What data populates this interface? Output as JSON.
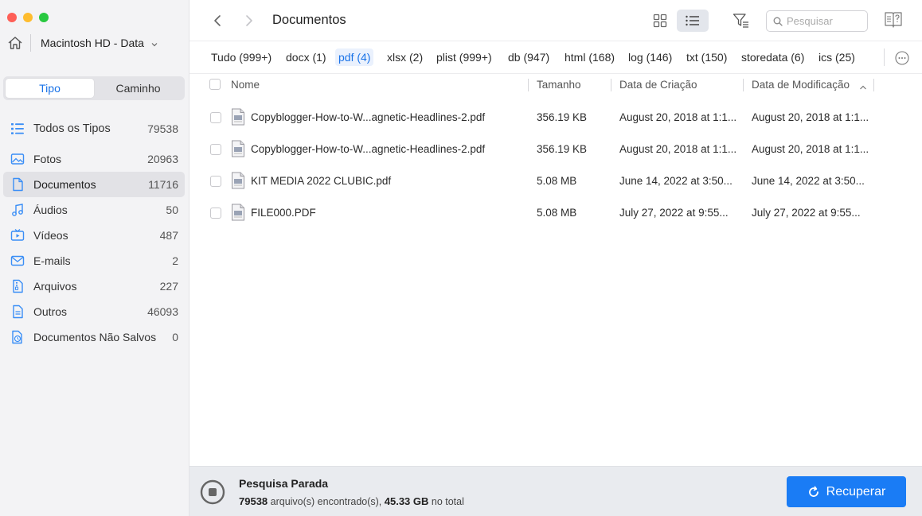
{
  "window": {
    "traffic_colors": [
      "#fe5f57",
      "#febc2e",
      "#28c840"
    ]
  },
  "sidebar": {
    "drive_label": "Macintosh HD - Data",
    "segment": {
      "tipo": "Tipo",
      "caminho": "Caminho"
    },
    "categories": [
      {
        "label": "Todos os Tipos",
        "count": "79538",
        "icon": "all-types-icon"
      },
      {
        "label": "Fotos",
        "count": "20963",
        "icon": "photo-icon"
      },
      {
        "label": "Documentos",
        "count": "11716",
        "icon": "document-icon"
      },
      {
        "label": "Áudios",
        "count": "50",
        "icon": "audio-icon"
      },
      {
        "label": "Vídeos",
        "count": "487",
        "icon": "video-icon"
      },
      {
        "label": "E-mails",
        "count": "2",
        "icon": "email-icon"
      },
      {
        "label": "Arquivos",
        "count": "227",
        "icon": "archive-icon"
      },
      {
        "label": "Outros",
        "count": "46093",
        "icon": "others-icon"
      },
      {
        "label": "Documentos Não Salvos",
        "count": "0",
        "icon": "unsaved-docs-icon"
      }
    ]
  },
  "toolbar": {
    "title": "Documentos",
    "search_placeholder": "Pesquisar"
  },
  "filters": [
    "Tudo (999+)",
    "docx (1)",
    "pdf (4)",
    "xlsx (2)",
    "plist (999+)",
    "db (947)",
    "html (168)",
    "log (146)",
    "txt (150)",
    "storedata (6)",
    "ics (25)"
  ],
  "table": {
    "columns": {
      "name": "Nome",
      "size": "Tamanho",
      "created": "Data de Criação",
      "modified": "Data de Modificação"
    },
    "rows": [
      {
        "name": "Copyblogger-How-to-W...agnetic-Headlines-2.pdf",
        "size": "356.19 KB",
        "created": "August 20, 2018 at 1:1...",
        "modified": "August 20, 2018 at 1:1..."
      },
      {
        "name": "Copyblogger-How-to-W...agnetic-Headlines-2.pdf",
        "size": "356.19 KB",
        "created": "August 20, 2018 at 1:1...",
        "modified": "August 20, 2018 at 1:1..."
      },
      {
        "name": "KIT MEDIA 2022 CLUBIC.pdf",
        "size": "5.08 MB",
        "created": "June 14, 2022 at 3:50...",
        "modified": "June 14, 2022 at 3:50..."
      },
      {
        "name": "FILE000.PDF",
        "size": "5.08 MB",
        "created": "July 27, 2022 at 9:55...",
        "modified": "July 27, 2022 at 9:55..."
      }
    ]
  },
  "footer": {
    "status_title": "Pesquisa Parada",
    "files_count": "79538",
    "files_text": " arquivo(s) encontrado(s), ",
    "total_size": "45.33 GB",
    "total_text": " no total",
    "recover_label": "Recuperar"
  },
  "colors": {
    "accent": "#1a73e8",
    "button": "#1a7cf5"
  }
}
